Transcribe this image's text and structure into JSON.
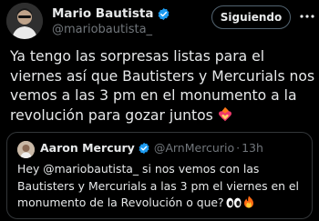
{
  "author": {
    "name": "Mario Bautista",
    "handle": "@mariobautista_",
    "verified": true
  },
  "follow_button": {
    "label": "Siguiendo"
  },
  "tweet": {
    "lines": [
      "Ya tengo las sorpresas listas para el",
      "viernes así que Bautisters y Mercurials nos",
      "vemos a las 3 pm en el monumento a la",
      "revolución para gozar juntos"
    ],
    "trailing_emoji": "heart-on-fire-icon"
  },
  "quoted_tweet": {
    "name": "Aaron Mercury",
    "handle": "@ArnMercurio",
    "separator": "·",
    "time": "13h",
    "verified": true,
    "lines": [
      "Hey @mariobautista_ si nos vemos con las",
      "Bautisters y Mercurials a las 3 pm el viernes en el",
      "monumento de la Revolución o que?"
    ],
    "trailing_emojis": [
      "eyes-icon",
      "fire-icon"
    ]
  },
  "colors": {
    "background": "#000000",
    "text": "#e7e9ea",
    "secondary_text": "#71767b",
    "verified_blue": "#1d9bf0",
    "border": "#333639"
  }
}
